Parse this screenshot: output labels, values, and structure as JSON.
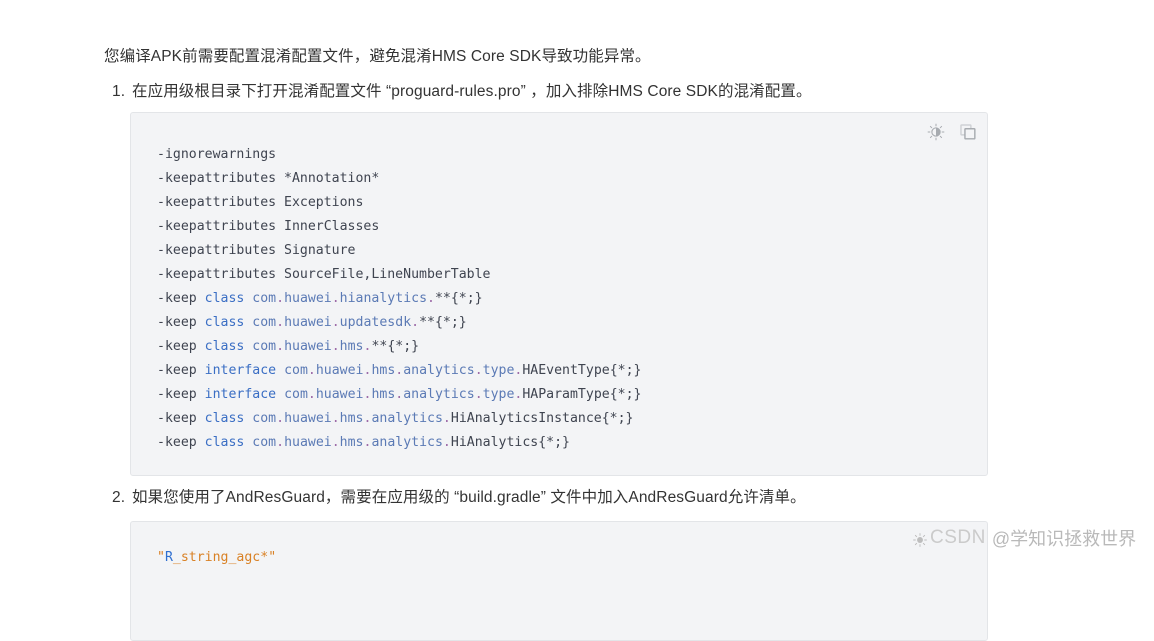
{
  "intro": {
    "text": "您编译APK前需要配置混淆配置文件，避免混淆HMS Core SDK导致功能异常。"
  },
  "list": [
    {
      "marker": "1.",
      "text": "在应用级根目录下打开混淆配置文件 “proguard-rules.pro” ，加入排除HMS Core SDK的混淆配置。"
    },
    {
      "marker": "2.",
      "text": "如果您使用了AndResGuard，需要在应用级的 “build.gradle” 文件中加入AndResGuard允许清单。"
    }
  ],
  "code_blocks": [
    {
      "id": "code-block-1",
      "toolbar": {
        "theme_icon": "brightness-icon",
        "copy_icon": "copy-icon"
      },
      "lines": [
        "-ignorewarnings",
        "-keepattributes *Annotation*",
        "-keepattributes Exceptions",
        "-keepattributes InnerClasses",
        "-keepattributes Signature",
        "-keepattributes SourceFile,LineNumberTable",
        "-keep class com.huawei.hianalytics.**{*;}",
        "-keep class com.huawei.updatesdk.**{*;}",
        "-keep class com.huawei.hms.**{*;}",
        "-keep interface com.huawei.hms.analytics.type.HAEventType{*;}",
        "-keep interface com.huawei.hms.analytics.type.HAParamType{*;}",
        "-keep class com.huawei.hms.analytics.HiAnalyticsInstance{*;}",
        "-keep class com.huawei.hms.analytics.HiAnalytics{*;}"
      ],
      "tokens": [
        [
          {
            "t": "-ignorewarnings",
            "c": "tok-plain"
          }
        ],
        [
          {
            "t": "-keepattributes *Annotation*",
            "c": "tok-plain"
          }
        ],
        [
          {
            "t": "-keepattributes Exceptions",
            "c": "tok-plain"
          }
        ],
        [
          {
            "t": "-keepattributes InnerClasses",
            "c": "tok-plain"
          }
        ],
        [
          {
            "t": "-keepattributes Signature",
            "c": "tok-plain"
          }
        ],
        [
          {
            "t": "-keepattributes SourceFile,LineNumberTable",
            "c": "tok-plain"
          }
        ],
        [
          {
            "t": "-keep ",
            "c": "tok-plain"
          },
          {
            "t": "class",
            "c": "tok-kw"
          },
          {
            "t": " ",
            "c": "tok-plain"
          },
          {
            "t": "com",
            "c": "tok-ident"
          },
          {
            "t": ".",
            "c": "tok-dot"
          },
          {
            "t": "huawei",
            "c": "tok-ident"
          },
          {
            "t": ".",
            "c": "tok-dot"
          },
          {
            "t": "hianalytics",
            "c": "tok-ident"
          },
          {
            "t": ".",
            "c": "tok-dot"
          },
          {
            "t": "**{*;}",
            "c": "tok-punct"
          }
        ],
        [
          {
            "t": "-keep ",
            "c": "tok-plain"
          },
          {
            "t": "class",
            "c": "tok-kw"
          },
          {
            "t": " ",
            "c": "tok-plain"
          },
          {
            "t": "com",
            "c": "tok-ident"
          },
          {
            "t": ".",
            "c": "tok-dot"
          },
          {
            "t": "huawei",
            "c": "tok-ident"
          },
          {
            "t": ".",
            "c": "tok-dot"
          },
          {
            "t": "updatesdk",
            "c": "tok-ident"
          },
          {
            "t": ".",
            "c": "tok-dot"
          },
          {
            "t": "**{*;}",
            "c": "tok-punct"
          }
        ],
        [
          {
            "t": "-keep ",
            "c": "tok-plain"
          },
          {
            "t": "class",
            "c": "tok-kw"
          },
          {
            "t": " ",
            "c": "tok-plain"
          },
          {
            "t": "com",
            "c": "tok-ident"
          },
          {
            "t": ".",
            "c": "tok-dot"
          },
          {
            "t": "huawei",
            "c": "tok-ident"
          },
          {
            "t": ".",
            "c": "tok-dot"
          },
          {
            "t": "hms",
            "c": "tok-ident"
          },
          {
            "t": ".",
            "c": "tok-dot"
          },
          {
            "t": "**{*;}",
            "c": "tok-punct"
          }
        ],
        [
          {
            "t": "-keep ",
            "c": "tok-plain"
          },
          {
            "t": "interface",
            "c": "tok-kw"
          },
          {
            "t": " ",
            "c": "tok-plain"
          },
          {
            "t": "com",
            "c": "tok-ident"
          },
          {
            "t": ".",
            "c": "tok-dot"
          },
          {
            "t": "huawei",
            "c": "tok-ident"
          },
          {
            "t": ".",
            "c": "tok-dot"
          },
          {
            "t": "hms",
            "c": "tok-ident"
          },
          {
            "t": ".",
            "c": "tok-dot"
          },
          {
            "t": "analytics",
            "c": "tok-ident"
          },
          {
            "t": ".",
            "c": "tok-dot"
          },
          {
            "t": "type",
            "c": "tok-ident"
          },
          {
            "t": ".",
            "c": "tok-dot"
          },
          {
            "t": "HAEventType{*;}",
            "c": "tok-punct"
          }
        ],
        [
          {
            "t": "-keep ",
            "c": "tok-plain"
          },
          {
            "t": "interface",
            "c": "tok-kw"
          },
          {
            "t": " ",
            "c": "tok-plain"
          },
          {
            "t": "com",
            "c": "tok-ident"
          },
          {
            "t": ".",
            "c": "tok-dot"
          },
          {
            "t": "huawei",
            "c": "tok-ident"
          },
          {
            "t": ".",
            "c": "tok-dot"
          },
          {
            "t": "hms",
            "c": "tok-ident"
          },
          {
            "t": ".",
            "c": "tok-dot"
          },
          {
            "t": "analytics",
            "c": "tok-ident"
          },
          {
            "t": ".",
            "c": "tok-dot"
          },
          {
            "t": "type",
            "c": "tok-ident"
          },
          {
            "t": ".",
            "c": "tok-dot"
          },
          {
            "t": "HAParamType{*;}",
            "c": "tok-punct"
          }
        ],
        [
          {
            "t": "-keep ",
            "c": "tok-plain"
          },
          {
            "t": "class",
            "c": "tok-kw"
          },
          {
            "t": " ",
            "c": "tok-plain"
          },
          {
            "t": "com",
            "c": "tok-ident"
          },
          {
            "t": ".",
            "c": "tok-dot"
          },
          {
            "t": "huawei",
            "c": "tok-ident"
          },
          {
            "t": ".",
            "c": "tok-dot"
          },
          {
            "t": "hms",
            "c": "tok-ident"
          },
          {
            "t": ".",
            "c": "tok-dot"
          },
          {
            "t": "analytics",
            "c": "tok-ident"
          },
          {
            "t": ".",
            "c": "tok-dot"
          },
          {
            "t": "HiAnalyticsInstance{*;}",
            "c": "tok-punct"
          }
        ],
        [
          {
            "t": "-keep ",
            "c": "tok-plain"
          },
          {
            "t": "class",
            "c": "tok-kw"
          },
          {
            "t": " ",
            "c": "tok-plain"
          },
          {
            "t": "com",
            "c": "tok-ident"
          },
          {
            "t": ".",
            "c": "tok-dot"
          },
          {
            "t": "huawei",
            "c": "tok-ident"
          },
          {
            "t": ".",
            "c": "tok-dot"
          },
          {
            "t": "hms",
            "c": "tok-ident"
          },
          {
            "t": ".",
            "c": "tok-dot"
          },
          {
            "t": "analytics",
            "c": "tok-ident"
          },
          {
            "t": ".",
            "c": "tok-dot"
          },
          {
            "t": "HiAnalytics{*;}",
            "c": "tok-punct"
          }
        ]
      ]
    },
    {
      "id": "code-block-2",
      "toolbar": {
        "theme_icon": "brightness-icon",
        "copy_icon": "copy-icon"
      },
      "lines": [
        "\"R_string_agc*\""
      ],
      "tokens": [
        [
          {
            "t": "\"",
            "c": "tok-str"
          },
          {
            "t": "R",
            "c": "tok-str-hl"
          },
          {
            "t": "_string_agc*",
            "c": "tok-str"
          },
          {
            "t": "\"",
            "c": "tok-str"
          }
        ]
      ]
    }
  ],
  "watermark": {
    "brand": "CSDN",
    "user": "@学知识拯救世界"
  },
  "colors": {
    "page_background": "#ffffff",
    "text": "#333333",
    "code_background": "#f3f4f6",
    "code_border": "#e3e5e8",
    "keyword": "#3a6ec4",
    "identifier": "#5b7ab5",
    "dot": "#9d6ba8",
    "string": "#d98125",
    "watermark": "#c9c9c9"
  }
}
